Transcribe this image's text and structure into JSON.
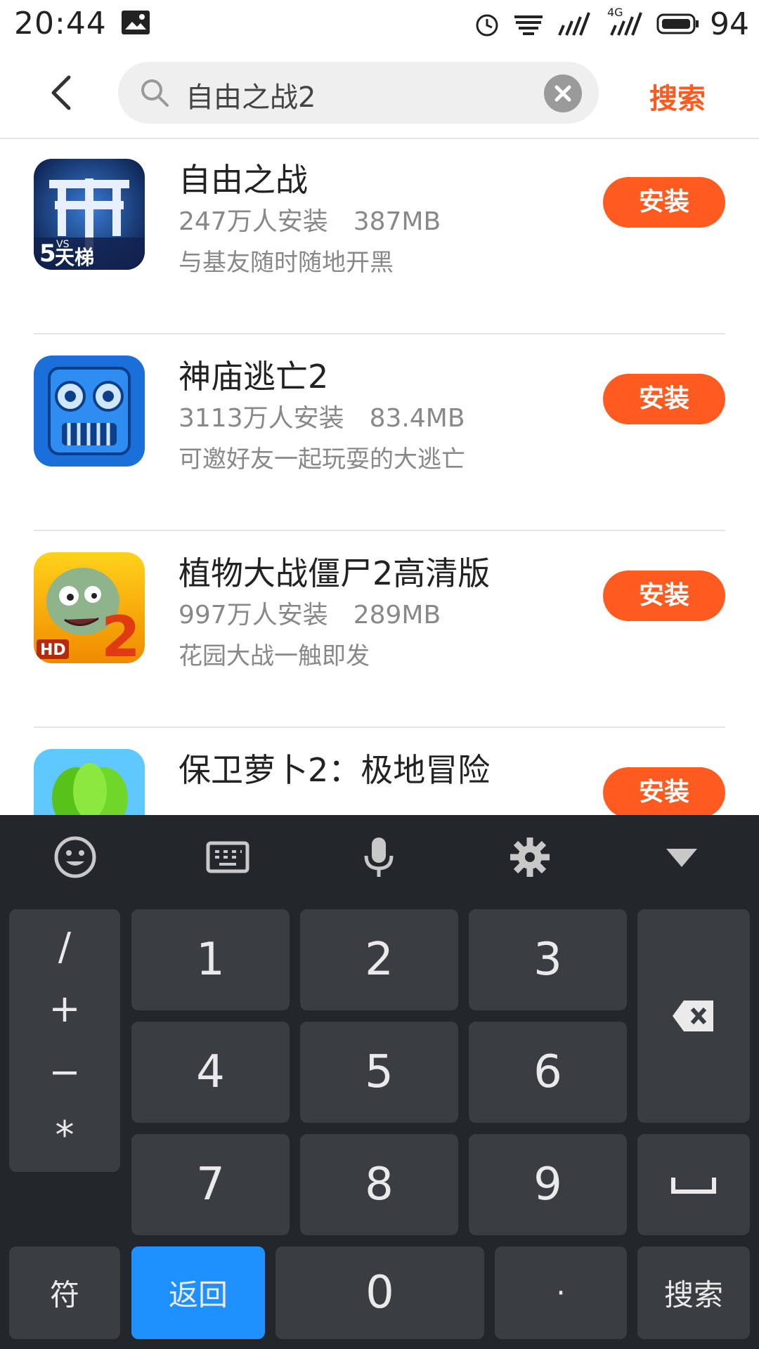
{
  "status_bar": {
    "time": "20:44",
    "battery": "94",
    "network": "4G"
  },
  "search": {
    "query": "自由之战2",
    "button": "搜索"
  },
  "colors": {
    "accent": "#ff5a1f",
    "keyboard_bg": "#23272b",
    "key_bg": "#3a3d41",
    "enter_blue": "#1e90ff"
  },
  "results": [
    {
      "name": "自由之战",
      "installs": "247万人安装",
      "size": "387MB",
      "desc": "与基友随时随地开黑",
      "action": "安装",
      "icon": "free-war-icon"
    },
    {
      "name": "神庙逃亡2",
      "installs": "3113万人安装",
      "size": "83.4MB",
      "desc": "可邀好友一起玩耍的大逃亡",
      "action": "安装",
      "icon": "temple-run-icon"
    },
    {
      "name": "植物大战僵尸2高清版",
      "installs": "997万人安装",
      "size": "289MB",
      "desc": "花园大战一触即发",
      "action": "安装",
      "icon": "pvz-icon"
    },
    {
      "name": "保卫萝卜2：极地冒险",
      "installs": "",
      "size": "",
      "desc": "",
      "action": "安装",
      "icon": "carrot-icon"
    }
  ],
  "keyboard": {
    "toolbar": [
      "emoji-icon",
      "keyboard-icon",
      "mic-icon",
      "settings-icon",
      "collapse-icon"
    ],
    "left_symbols": [
      "/",
      "+",
      "−",
      "*"
    ],
    "digits": [
      "1",
      "2",
      "3",
      "4",
      "5",
      "6",
      "7",
      "8",
      "9"
    ],
    "bottom": {
      "fu": "符",
      "back": "返回",
      "zero": "0",
      "dot": "·",
      "search": "搜索"
    }
  }
}
